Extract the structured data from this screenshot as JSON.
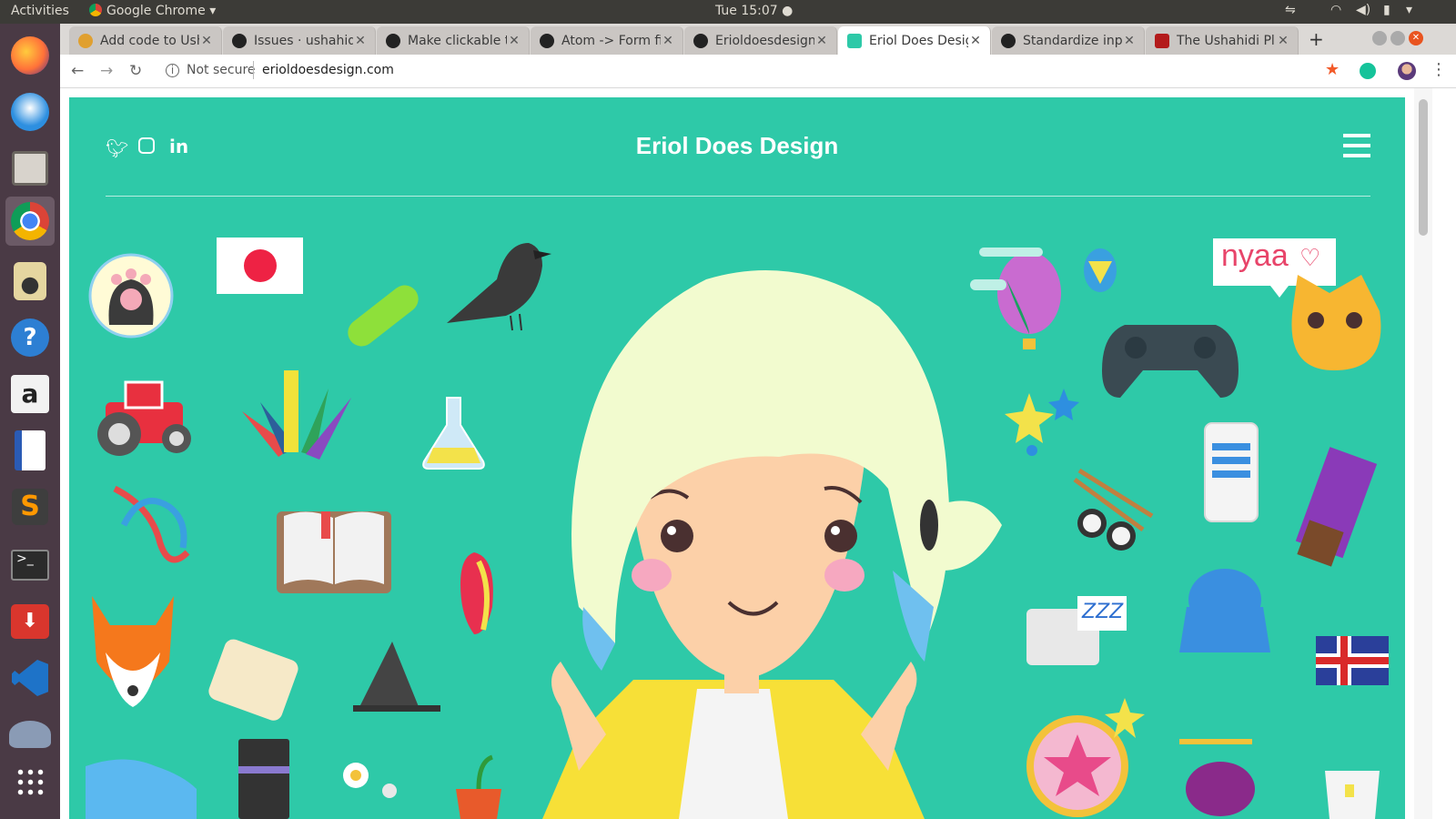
{
  "system": {
    "activities": "Activities",
    "app_menu": "Google Chrome",
    "clock": "Tue 15:07"
  },
  "tabs": [
    {
      "label": "Add code to Ush",
      "icon": "ushahidi-icon",
      "color": "#e0a030"
    },
    {
      "label": "Issues · ushahid",
      "icon": "github-icon",
      "color": "#222222"
    },
    {
      "label": "Make clickable t",
      "icon": "github-icon",
      "color": "#222222"
    },
    {
      "label": "Atom -> Form fi",
      "icon": "github-icon",
      "color": "#222222"
    },
    {
      "label": "Erioldoesdesign",
      "icon": "github-icon",
      "color": "#222222"
    },
    {
      "label": "Eriol Does Desig",
      "icon": "site-favicon-icon",
      "color": "#2ec9a8"
    },
    {
      "label": "Standardize inp",
      "icon": "github-icon",
      "color": "#222222"
    },
    {
      "label": "The Ushahidi Pl",
      "icon": "ushahidi-platform-icon",
      "color": "#b31b1b"
    }
  ],
  "address": {
    "security": "Not secure",
    "url": "erioldoesdesign.com"
  },
  "site": {
    "title": "Eriol Does Design",
    "bubble": "nyaa",
    "zzz": "ZZZ"
  },
  "colors": {
    "hero": "#2ec9a8",
    "accent": "#e8456a"
  }
}
